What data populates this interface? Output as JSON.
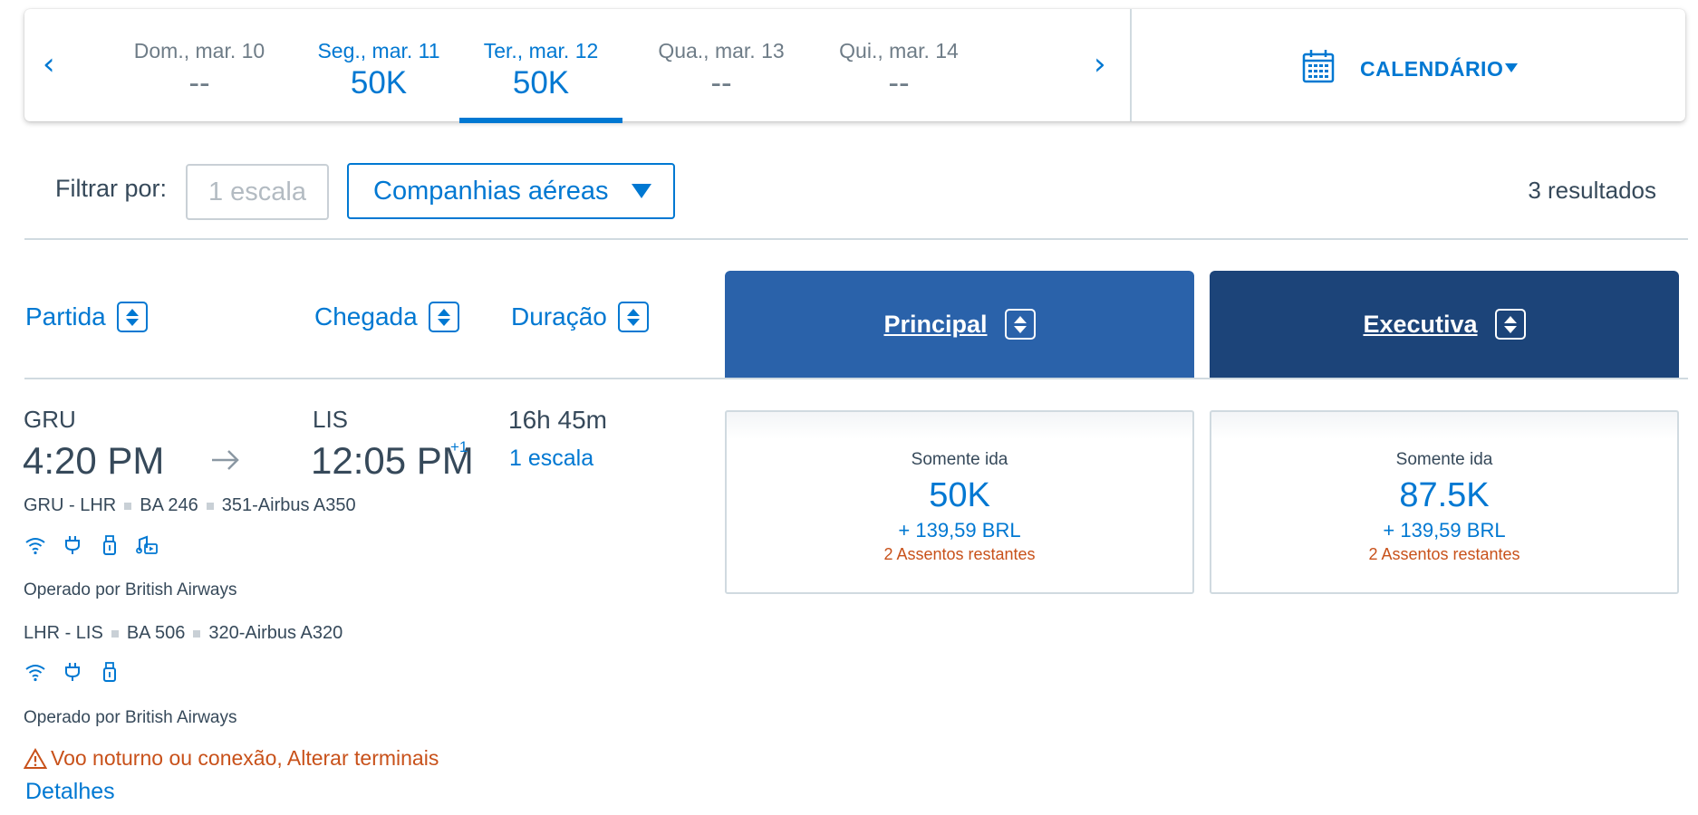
{
  "date_strip": {
    "prev_arrow": "‹",
    "next_arrow": "›",
    "dates": [
      {
        "label": "Dom., mar. 10",
        "price": "--"
      },
      {
        "label": "Seg., mar. 11",
        "price": "50K"
      },
      {
        "label": "Ter., mar. 12",
        "price": "50K",
        "selected": true
      },
      {
        "label": "Qua., mar. 13",
        "price": "--"
      },
      {
        "label": "Qui., mar. 14",
        "price": "--"
      }
    ],
    "calendar_label": "CALENDÁRIO",
    "calendar_icon": "calendar-icon"
  },
  "filters": {
    "label": "Filtrar por:",
    "stops_button": "1 escala",
    "airlines_dropdown": "Companhias aéreas",
    "results_count": "3 resultados"
  },
  "columns": {
    "departure": "Partida",
    "arrival": "Chegada",
    "duration": "Duração",
    "cabin_main": "Principal",
    "cabin_business": "Executiva"
  },
  "flight": {
    "origin": "GRU",
    "destination": "LIS",
    "depart_time": "4:20 PM",
    "arrive_time": "12:05 PM",
    "day_offset": "+1",
    "duration": "16h 45m",
    "stops": "1 escala",
    "segments": [
      {
        "route": "GRU - LHR",
        "flight_no": "BA 246",
        "aircraft": "351-Airbus A350",
        "amenities": [
          "wifi-icon",
          "power-plug-icon",
          "usb-icon",
          "entertainment-icon"
        ],
        "operated_by": "Operado por British Airways"
      },
      {
        "route": "LHR - LIS",
        "flight_no": "BA 506",
        "aircraft": "320-Airbus A320",
        "amenities": [
          "wifi-icon",
          "power-plug-icon",
          "usb-icon"
        ],
        "operated_by": "Operado por British Airways"
      }
    ],
    "warning": "Voo noturno ou conexão, Alterar terminais",
    "details_link": "Detalhes",
    "fares": {
      "main": {
        "type": "Somente ida",
        "miles": "50K",
        "taxes": "+ 139,59 BRL",
        "seats": "2 Assentos restantes"
      },
      "business": {
        "type": "Somente ida",
        "miles": "87.5K",
        "taxes": "+ 139,59 BRL",
        "seats": "2 Assentos restantes"
      }
    }
  },
  "colors": {
    "accent": "#0078d2",
    "main_cabin": "#2a62aa",
    "business_cabin": "#1c4479",
    "warning": "#c8511a",
    "text": "#36495a"
  }
}
